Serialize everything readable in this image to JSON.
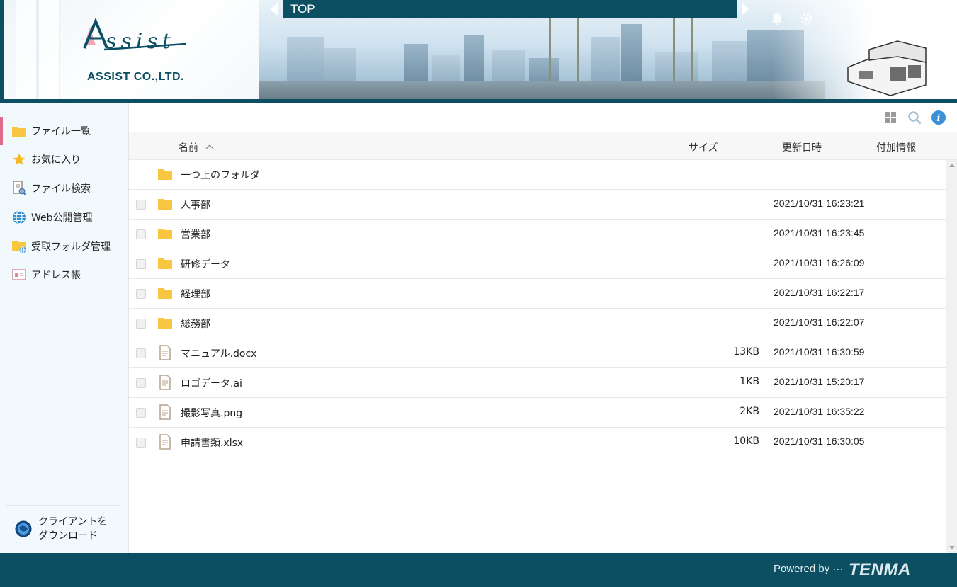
{
  "header": {
    "company_name": "ASSIST CO.,LTD.",
    "logo_wordmark": "Assist",
    "breadcrumb": "TOP"
  },
  "sidebar": {
    "items": [
      {
        "label": "ファイル一覧",
        "icon": "folder-icon",
        "active": true
      },
      {
        "label": "お気に入り",
        "icon": "star-icon",
        "active": false
      },
      {
        "label": "ファイル検索",
        "icon": "file-search-icon",
        "active": false
      },
      {
        "label": "Web公開管理",
        "icon": "globe-icon",
        "active": false
      },
      {
        "label": "受取フォルダ管理",
        "icon": "inbox-folder-icon",
        "active": false
      },
      {
        "label": "アドレス帳",
        "icon": "address-card-icon",
        "active": false
      }
    ],
    "download": {
      "line1": "クライアントを",
      "line2": "ダウンロード"
    }
  },
  "table": {
    "columns": {
      "name": "名前",
      "size": "サイズ",
      "modified": "更新日時",
      "extra": "付加情報"
    },
    "parent_folder": "一つ上のフォルダ",
    "rows": [
      {
        "name": "人事部",
        "type": "folder",
        "size": "",
        "modified": "2021/10/31 16:23:21"
      },
      {
        "name": "営業部",
        "type": "folder",
        "size": "",
        "modified": "2021/10/31 16:23:45"
      },
      {
        "name": "研修データ",
        "type": "folder",
        "size": "",
        "modified": "2021/10/31 16:26:09"
      },
      {
        "name": "経理部",
        "type": "folder",
        "size": "",
        "modified": "2021/10/31 16:22:17"
      },
      {
        "name": "総務部",
        "type": "folder",
        "size": "",
        "modified": "2021/10/31 16:22:07"
      },
      {
        "name": "マニュアル.docx",
        "type": "file",
        "size": "13KB",
        "modified": "2021/10/31 16:30:59"
      },
      {
        "name": "ロゴデータ.ai",
        "type": "file",
        "size": "1KB",
        "modified": "2021/10/31 15:20:17"
      },
      {
        "name": "撮影写真.png",
        "type": "file",
        "size": "2KB",
        "modified": "2021/10/31 16:35:22"
      },
      {
        "name": "申請書類.xlsx",
        "type": "file",
        "size": "10KB",
        "modified": "2021/10/31 16:30:05"
      }
    ]
  },
  "footer": {
    "powered_by": "Powered by ···",
    "brand": "TENMA"
  },
  "colors": {
    "primary": "#0c4f63",
    "accent": "#e06b8b",
    "folder": "#f9c642",
    "info": "#3d8fd6"
  }
}
